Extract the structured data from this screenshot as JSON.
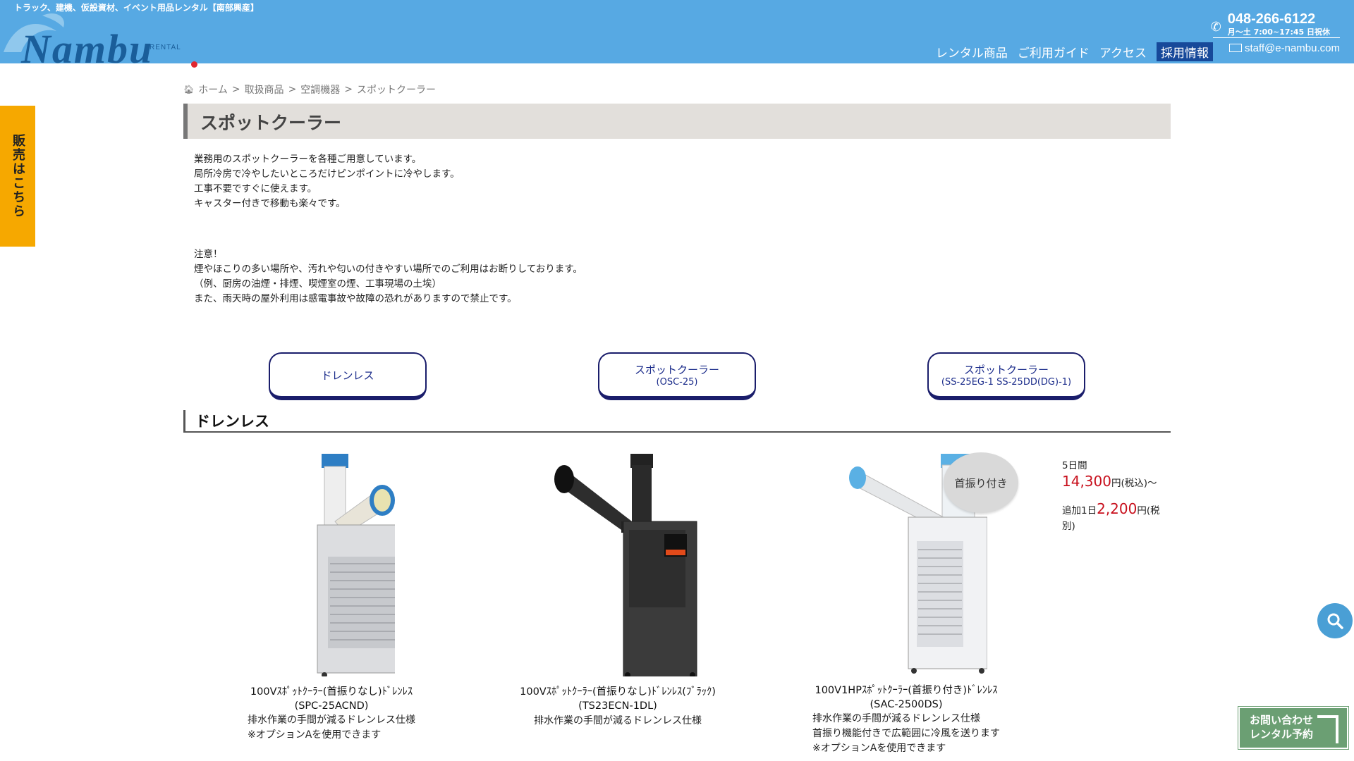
{
  "header": {
    "tagline": "トラック、建機、仮設資材、イベント用品レンタル【南部興産】",
    "logo_text": "Nambu",
    "logo_sub": "RENTAL",
    "phone": "048-266-6122",
    "hours": "月〜土 7:00~17:45 日祝休",
    "nav": [
      "レンタル商品",
      "ご利用ガイド",
      "アクセス",
      "採用情報"
    ],
    "email": "staff@e-nambu.com"
  },
  "sale_tab": "販売はこちら",
  "breadcrumb": [
    "ホーム",
    "取扱商品",
    "空調機器",
    "スポットクーラー"
  ],
  "breadcrumb_sep": ">",
  "page_title": "スポットクーラー",
  "intro": [
    "業務用のスポットクーラーを各種ご用意しています。",
    "局所冷房で冷やしたいところだけピンポイントに冷やします。",
    "工事不要ですぐに使えます。",
    "キャスター付きで移動も楽々です。"
  ],
  "notice": [
    "注意！",
    "煙やほこりの多い場所や、汚れや匂いの付きやすい場所でのご利用はお断りしております。",
    "（例、厨房の油煙・排煙、喫煙室の煙、工事現場の土埃）",
    "また、雨天時の屋外利用は感電事故や故障の恐れがありますので禁止です。"
  ],
  "anchors": [
    {
      "label": "ドレンレス",
      "sub": ""
    },
    {
      "label": "スポットクーラー",
      "sub": "(OSC-25)"
    },
    {
      "label": "スポットクーラー",
      "sub": "(SS-25EG-1 SS-25DD(DG)-1)"
    }
  ],
  "section_title": "ドレンレス",
  "products": [
    {
      "name": "100Vｽﾎﾟｯﾄｸｰﾗｰ(首振りなし)ﾄﾞﾚﾝﾚｽ",
      "model": "(SPC-25ACND)",
      "desc": [
        "排水作業の手間が減るドレンレス仕様",
        "※オプションAを使用できます"
      ]
    },
    {
      "name": "100Vｽﾎﾟｯﾄｸｰﾗｰ(首振りなし)ﾄﾞﾚﾝﾚｽ(ﾌﾞﾗｯｸ)",
      "model": "(TS23ECN-1DL)",
      "desc": [
        "排水作業の手間が減るドレンレス仕様"
      ]
    },
    {
      "name": "100V1HPｽﾎﾟｯﾄｸｰﾗｰ(首振り付き)ﾄﾞﾚﾝﾚｽ",
      "model": "(SAC-2500DS)",
      "desc": [
        "排水作業の手間が減るドレンレス仕様",
        "首振り機能付きで広範囲に冷風を送ります",
        "※オプションAを使用できます"
      ],
      "badge": "首振り付き"
    }
  ],
  "price": {
    "period_label": "5日間",
    "period_price": "14,300",
    "period_suffix": "円(税込)〜",
    "extra_label": "追加1日",
    "extra_price": "2,200",
    "extra_suffix": "円(税別)"
  },
  "contact": [
    "お問い合わせ",
    "レンタル予約"
  ],
  "colors": {
    "header": "#57a9e3",
    "navy": "#1a1d6b",
    "price_red": "#c8101d",
    "sale_tab": "#f6a800"
  }
}
